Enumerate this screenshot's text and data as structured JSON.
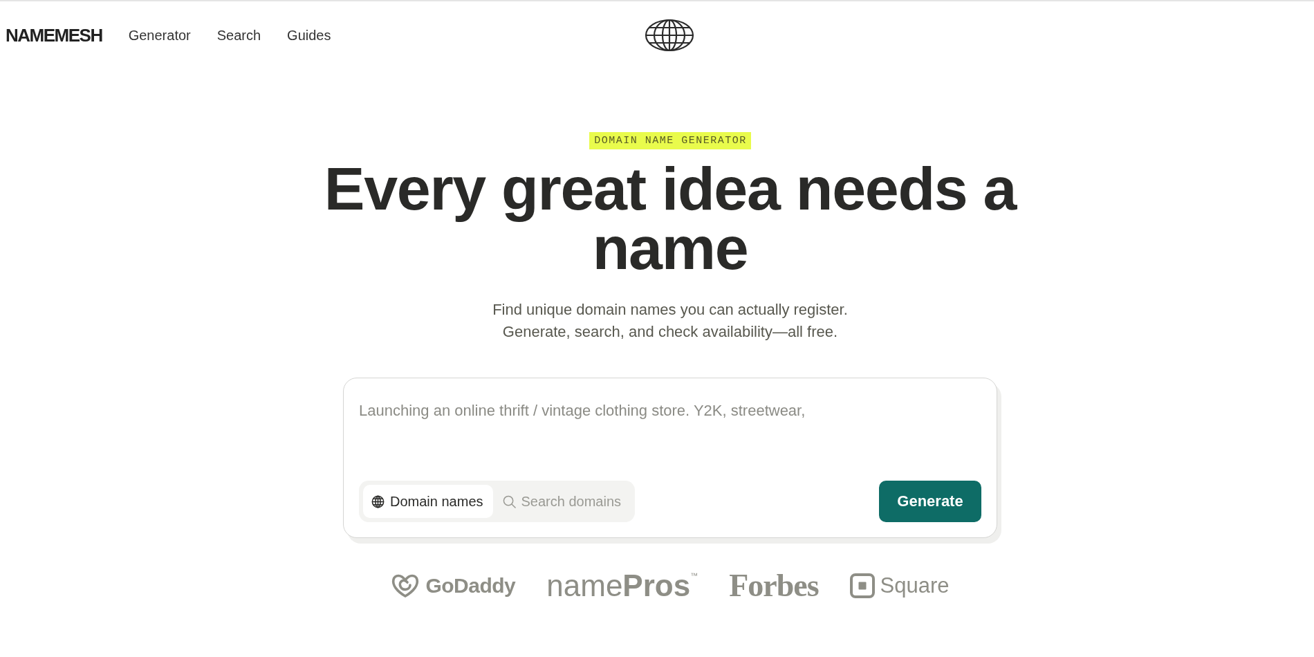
{
  "header": {
    "brand": "NAMEMESH",
    "nav": [
      {
        "label": "Generator"
      },
      {
        "label": "Search"
      },
      {
        "label": "Guides"
      }
    ]
  },
  "hero": {
    "badge": "DOMAIN NAME GENERATOR",
    "title": "Every great idea needs a name",
    "subtitle": [
      "Find unique domain names you can actually register.",
      "Generate, search, and check availability—all free."
    ]
  },
  "generator": {
    "prompt": {
      "placeholder": "Launching an online thrift / vintage clothing store. Y2K, streetwear,"
    },
    "modes": [
      {
        "label": "Domain names",
        "selected": true
      },
      {
        "label": "Search domains",
        "selected": false
      }
    ],
    "submit": "Generate"
  },
  "logos": [
    {
      "kind": "emblem",
      "text": "GoDaddy"
    },
    {
      "kind": "wordmark",
      "text": "name**Pros**$^{™}$"
    },
    {
      "kind": "serif",
      "text": "Forbes"
    },
    {
      "kind": "tile",
      "text": "Square"
    }
  ]
}
